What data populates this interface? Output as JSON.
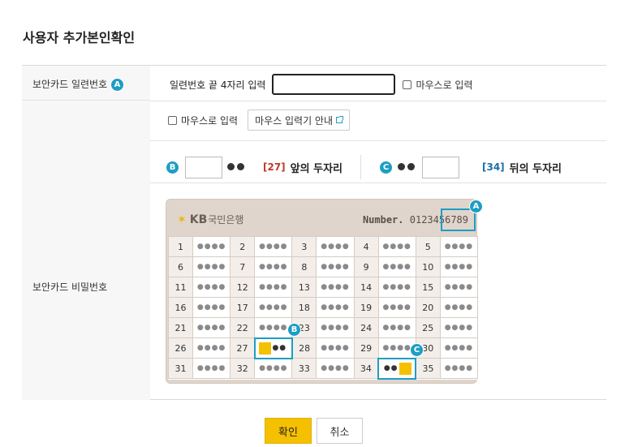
{
  "title": "사용자 추가본인확인",
  "serial_row": {
    "label": "보안카드 일련번호",
    "badge": "A",
    "prompt": "일련번호 끝 4자리 입력",
    "input_value": "",
    "mouse_input_label": "마우스로 입력"
  },
  "password_row": {
    "label": "보안카드 비밀번호",
    "mouse_input_label": "마우스로 입력",
    "guide_button": "마우스 입력기 안내",
    "front": {
      "badge": "B",
      "number": "[27]",
      "desc": "앞의 두자리"
    },
    "back": {
      "badge": "C",
      "number": "[34]",
      "desc": "뒤의 두자리"
    }
  },
  "card": {
    "bank_name": "KB국민은행",
    "logo_text": "KB",
    "bank_sub": "국민은행",
    "number_label": "Number.",
    "number_value": "0123456789",
    "mask": "●●●●",
    "rows": [
      [
        "1",
        "2",
        "3",
        "4",
        "5"
      ],
      [
        "6",
        "7",
        "8",
        "9",
        "10"
      ],
      [
        "11",
        "12",
        "13",
        "14",
        "15"
      ],
      [
        "16",
        "17",
        "18",
        "19",
        "20"
      ],
      [
        "21",
        "22",
        "23",
        "24",
        "25"
      ],
      [
        "26",
        "27",
        "28",
        "29",
        "30"
      ],
      [
        "31",
        "32",
        "33",
        "34",
        "35"
      ]
    ],
    "badges": {
      "a": "A",
      "b": "B",
      "c": "C"
    }
  },
  "buttons": {
    "confirm": "확인",
    "cancel": "취소"
  },
  "colors": {
    "accent": "#f5c000",
    "badge": "#1d9ec3"
  }
}
